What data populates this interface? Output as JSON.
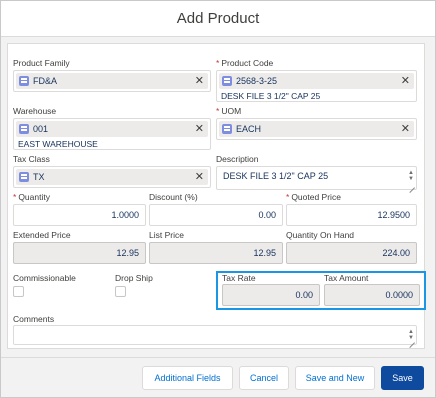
{
  "header": {
    "title": "Add Product"
  },
  "form": {
    "product_family": {
      "label": "Product Family",
      "value": "FD&A"
    },
    "product_code": {
      "label": "Product Code",
      "value": "2568-3-25",
      "detail": "DESK FILE 3 1/2\" CAP 25"
    },
    "warehouse": {
      "label": "Warehouse",
      "value": "001",
      "detail": "EAST WAREHOUSE"
    },
    "uom": {
      "label": "UOM",
      "value": "EACH"
    },
    "tax_class": {
      "label": "Tax Class",
      "value": "TX"
    },
    "description": {
      "label": "Description",
      "value": "DESK FILE 3 1/2\" CAP 25"
    },
    "quantity": {
      "label": "Quantity",
      "value": "1.0000"
    },
    "discount": {
      "label": "Discount (%)",
      "value": "0.00"
    },
    "quoted_price": {
      "label": "Quoted Price",
      "value": "12.9500"
    },
    "extended_price": {
      "label": "Extended Price",
      "value": "12.95"
    },
    "list_price": {
      "label": "List Price",
      "value": "12.95"
    },
    "quantity_on_hand": {
      "label": "Quantity On Hand",
      "value": "224.00"
    },
    "commissionable": {
      "label": "Commissionable",
      "checked": false
    },
    "drop_ship": {
      "label": "Drop Ship",
      "checked": false
    },
    "tax_rate": {
      "label": "Tax Rate",
      "value": "0.00"
    },
    "tax_amount": {
      "label": "Tax Amount",
      "value": "0.0000"
    },
    "comments": {
      "label": "Comments",
      "value": ""
    },
    "clear_symbol": "✕",
    "required_symbol": "*"
  },
  "footer": {
    "additional_fields": "Additional Fields",
    "cancel": "Cancel",
    "save_and_new": "Save and New",
    "save": "Save"
  },
  "colors": {
    "brand": "#0e4a9e",
    "link": "#0070d2",
    "focus_border": "#1b96e5",
    "required": "#c23934"
  },
  "icons": [
    "record-icon",
    "clear-icon",
    "resize-grip-icon",
    "stepper-icon",
    "checkbox"
  ]
}
